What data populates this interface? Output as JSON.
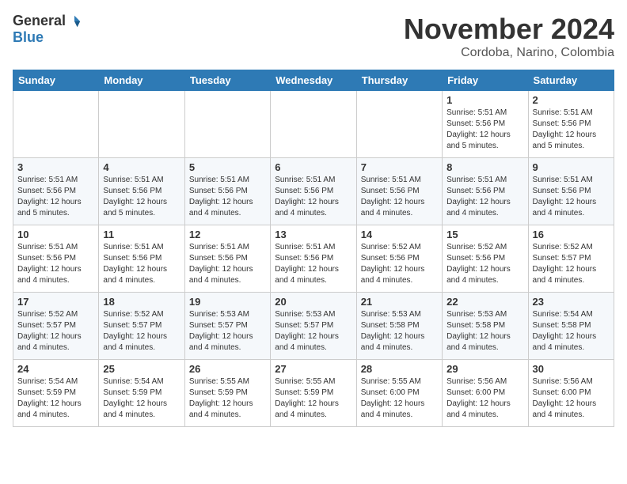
{
  "header": {
    "logo_general": "General",
    "logo_blue": "Blue",
    "month_title": "November 2024",
    "location": "Cordoba, Narino, Colombia"
  },
  "weekdays": [
    "Sunday",
    "Monday",
    "Tuesday",
    "Wednesday",
    "Thursday",
    "Friday",
    "Saturday"
  ],
  "weeks": [
    [
      {
        "day": "",
        "info": ""
      },
      {
        "day": "",
        "info": ""
      },
      {
        "day": "",
        "info": ""
      },
      {
        "day": "",
        "info": ""
      },
      {
        "day": "",
        "info": ""
      },
      {
        "day": "1",
        "info": "Sunrise: 5:51 AM\nSunset: 5:56 PM\nDaylight: 12 hours\nand 5 minutes."
      },
      {
        "day": "2",
        "info": "Sunrise: 5:51 AM\nSunset: 5:56 PM\nDaylight: 12 hours\nand 5 minutes."
      }
    ],
    [
      {
        "day": "3",
        "info": "Sunrise: 5:51 AM\nSunset: 5:56 PM\nDaylight: 12 hours\nand 5 minutes."
      },
      {
        "day": "4",
        "info": "Sunrise: 5:51 AM\nSunset: 5:56 PM\nDaylight: 12 hours\nand 5 minutes."
      },
      {
        "day": "5",
        "info": "Sunrise: 5:51 AM\nSunset: 5:56 PM\nDaylight: 12 hours\nand 4 minutes."
      },
      {
        "day": "6",
        "info": "Sunrise: 5:51 AM\nSunset: 5:56 PM\nDaylight: 12 hours\nand 4 minutes."
      },
      {
        "day": "7",
        "info": "Sunrise: 5:51 AM\nSunset: 5:56 PM\nDaylight: 12 hours\nand 4 minutes."
      },
      {
        "day": "8",
        "info": "Sunrise: 5:51 AM\nSunset: 5:56 PM\nDaylight: 12 hours\nand 4 minutes."
      },
      {
        "day": "9",
        "info": "Sunrise: 5:51 AM\nSunset: 5:56 PM\nDaylight: 12 hours\nand 4 minutes."
      }
    ],
    [
      {
        "day": "10",
        "info": "Sunrise: 5:51 AM\nSunset: 5:56 PM\nDaylight: 12 hours\nand 4 minutes."
      },
      {
        "day": "11",
        "info": "Sunrise: 5:51 AM\nSunset: 5:56 PM\nDaylight: 12 hours\nand 4 minutes."
      },
      {
        "day": "12",
        "info": "Sunrise: 5:51 AM\nSunset: 5:56 PM\nDaylight: 12 hours\nand 4 minutes."
      },
      {
        "day": "13",
        "info": "Sunrise: 5:51 AM\nSunset: 5:56 PM\nDaylight: 12 hours\nand 4 minutes."
      },
      {
        "day": "14",
        "info": "Sunrise: 5:52 AM\nSunset: 5:56 PM\nDaylight: 12 hours\nand 4 minutes."
      },
      {
        "day": "15",
        "info": "Sunrise: 5:52 AM\nSunset: 5:56 PM\nDaylight: 12 hours\nand 4 minutes."
      },
      {
        "day": "16",
        "info": "Sunrise: 5:52 AM\nSunset: 5:57 PM\nDaylight: 12 hours\nand 4 minutes."
      }
    ],
    [
      {
        "day": "17",
        "info": "Sunrise: 5:52 AM\nSunset: 5:57 PM\nDaylight: 12 hours\nand 4 minutes."
      },
      {
        "day": "18",
        "info": "Sunrise: 5:52 AM\nSunset: 5:57 PM\nDaylight: 12 hours\nand 4 minutes."
      },
      {
        "day": "19",
        "info": "Sunrise: 5:53 AM\nSunset: 5:57 PM\nDaylight: 12 hours\nand 4 minutes."
      },
      {
        "day": "20",
        "info": "Sunrise: 5:53 AM\nSunset: 5:57 PM\nDaylight: 12 hours\nand 4 minutes."
      },
      {
        "day": "21",
        "info": "Sunrise: 5:53 AM\nSunset: 5:58 PM\nDaylight: 12 hours\nand 4 minutes."
      },
      {
        "day": "22",
        "info": "Sunrise: 5:53 AM\nSunset: 5:58 PM\nDaylight: 12 hours\nand 4 minutes."
      },
      {
        "day": "23",
        "info": "Sunrise: 5:54 AM\nSunset: 5:58 PM\nDaylight: 12 hours\nand 4 minutes."
      }
    ],
    [
      {
        "day": "24",
        "info": "Sunrise: 5:54 AM\nSunset: 5:59 PM\nDaylight: 12 hours\nand 4 minutes."
      },
      {
        "day": "25",
        "info": "Sunrise: 5:54 AM\nSunset: 5:59 PM\nDaylight: 12 hours\nand 4 minutes."
      },
      {
        "day": "26",
        "info": "Sunrise: 5:55 AM\nSunset: 5:59 PM\nDaylight: 12 hours\nand 4 minutes."
      },
      {
        "day": "27",
        "info": "Sunrise: 5:55 AM\nSunset: 5:59 PM\nDaylight: 12 hours\nand 4 minutes."
      },
      {
        "day": "28",
        "info": "Sunrise: 5:55 AM\nSunset: 6:00 PM\nDaylight: 12 hours\nand 4 minutes."
      },
      {
        "day": "29",
        "info": "Sunrise: 5:56 AM\nSunset: 6:00 PM\nDaylight: 12 hours\nand 4 minutes."
      },
      {
        "day": "30",
        "info": "Sunrise: 5:56 AM\nSunset: 6:00 PM\nDaylight: 12 hours\nand 4 minutes."
      }
    ]
  ]
}
